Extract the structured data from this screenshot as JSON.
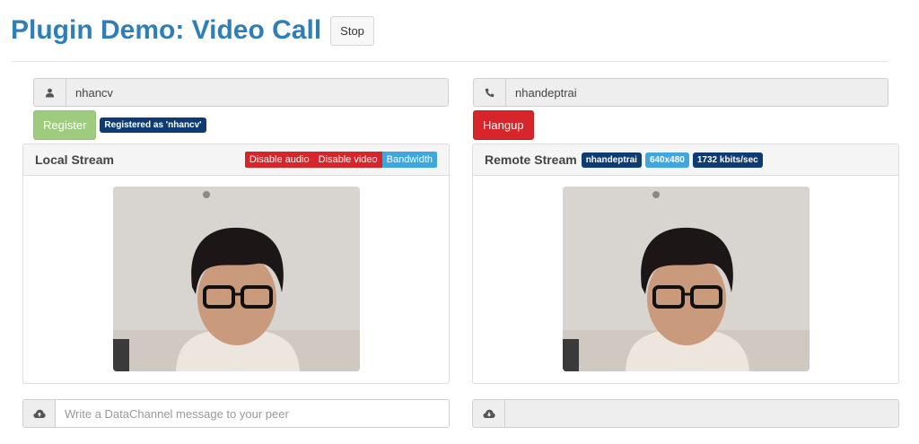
{
  "header": {
    "title": "Plugin Demo: Video Call",
    "stop_label": "Stop"
  },
  "local": {
    "username_value": "nhancv",
    "register_label": "Register",
    "registered_label": "Registered as 'nhancv'",
    "panel_title": "Local Stream",
    "controls": [
      "Disable audio",
      "Disable video",
      "Bandwidth"
    ],
    "chat_placeholder": "Write a DataChannel message to your peer"
  },
  "remote": {
    "peer_value": "nhandeptrai",
    "hangup_label": "Hangup",
    "panel_title": "Remote Stream",
    "peer_badge": "nhandeptrai",
    "resolution_badge": "640x480",
    "bitrate_badge": "1732 kbits/sec",
    "chat_value": ""
  },
  "icons": {
    "user": "user-icon",
    "phone": "phone-icon",
    "cloud": "cloud-upload-icon",
    "cloud_download": "cloud-download-icon"
  },
  "colors": {
    "title": "#2e7fb8",
    "success": "#9ecb7e",
    "danger": "#d6262b",
    "info": "#3fa7e0",
    "primary": "#0e3b73"
  }
}
